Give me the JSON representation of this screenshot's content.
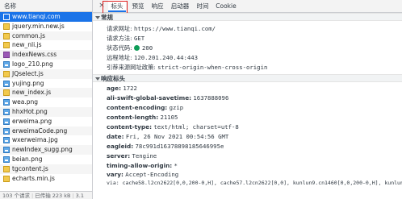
{
  "list": {
    "header": "名称",
    "items": [
      {
        "name": "www.tianqi.com",
        "type": "doc",
        "selected": true
      },
      {
        "name": "jquery.min.new.js",
        "type": "js"
      },
      {
        "name": "common.js",
        "type": "js"
      },
      {
        "name": "new_nli.js",
        "type": "js"
      },
      {
        "name": "indexNews.css",
        "type": "css"
      },
      {
        "name": "logo_210.png",
        "type": "img"
      },
      {
        "name": "JQselect.js",
        "type": "js"
      },
      {
        "name": "yujing.png",
        "type": "img"
      },
      {
        "name": "new_index.js",
        "type": "js"
      },
      {
        "name": "wea.png",
        "type": "img"
      },
      {
        "name": "hhxHot.png",
        "type": "img"
      },
      {
        "name": "erweima.png",
        "type": "img"
      },
      {
        "name": "erweimaCode.png",
        "type": "img"
      },
      {
        "name": "wxerweima.jpg",
        "type": "img"
      },
      {
        "name": "newIndex_sugg.png",
        "type": "img"
      },
      {
        "name": "beian.png",
        "type": "img"
      },
      {
        "name": "tgcontent.js",
        "type": "js"
      },
      {
        "name": "echarts.min.js",
        "type": "js"
      }
    ],
    "footer": {
      "requests": "103 个请求",
      "transferred": "已传输 223 kB",
      "more": "3.1"
    }
  },
  "tabs": {
    "close_icon": "×",
    "items": [
      "标头",
      "预览",
      "响应",
      "启动器",
      "时间",
      "Cookie"
    ],
    "active_index": 0
  },
  "general": {
    "title": "常规",
    "rows": [
      {
        "key": "请求网址:",
        "value": "https://www.tianqi.com/"
      },
      {
        "key": "请求方法:",
        "value": "GET"
      },
      {
        "key": "状态代码:",
        "value": "200"
      },
      {
        "key": "远程地址:",
        "value": "120.201.240.44:443"
      },
      {
        "key": "引荐来源网址政策:",
        "value": "strict-origin-when-cross-origin"
      }
    ]
  },
  "response": {
    "title": "响应标头",
    "rows": [
      {
        "key": "age:",
        "value": "1722"
      },
      {
        "key": "ali-swift-global-savetime:",
        "value": "1637888096"
      },
      {
        "key": "content-encoding:",
        "value": "gzip"
      },
      {
        "key": "content-length:",
        "value": "21105"
      },
      {
        "key": "content-type:",
        "value": "text/html; charset=utf-8"
      },
      {
        "key": "date:",
        "value": "Fri, 26 Nov 2021 00:54:56 GMT"
      },
      {
        "key": "eagleid:",
        "value": "78c991d16378898185646995e"
      },
      {
        "key": "server:",
        "value": "Tengine"
      },
      {
        "key": "timing-allow-origin:",
        "value": "*"
      },
      {
        "key": "vary:",
        "value": "Accept-Encoding"
      }
    ],
    "truncated_line": "via: cache58.l2cn2622[0,0,200-0,H], cache57.l2cn2622[0,0], kunlun9.cn1460[0,0,200-0,H], kunlun9.cn1"
  },
  "colors": {
    "accent": "#1a73e8",
    "status_ok": "#0f9d58",
    "highlight_box": "#e02020"
  }
}
